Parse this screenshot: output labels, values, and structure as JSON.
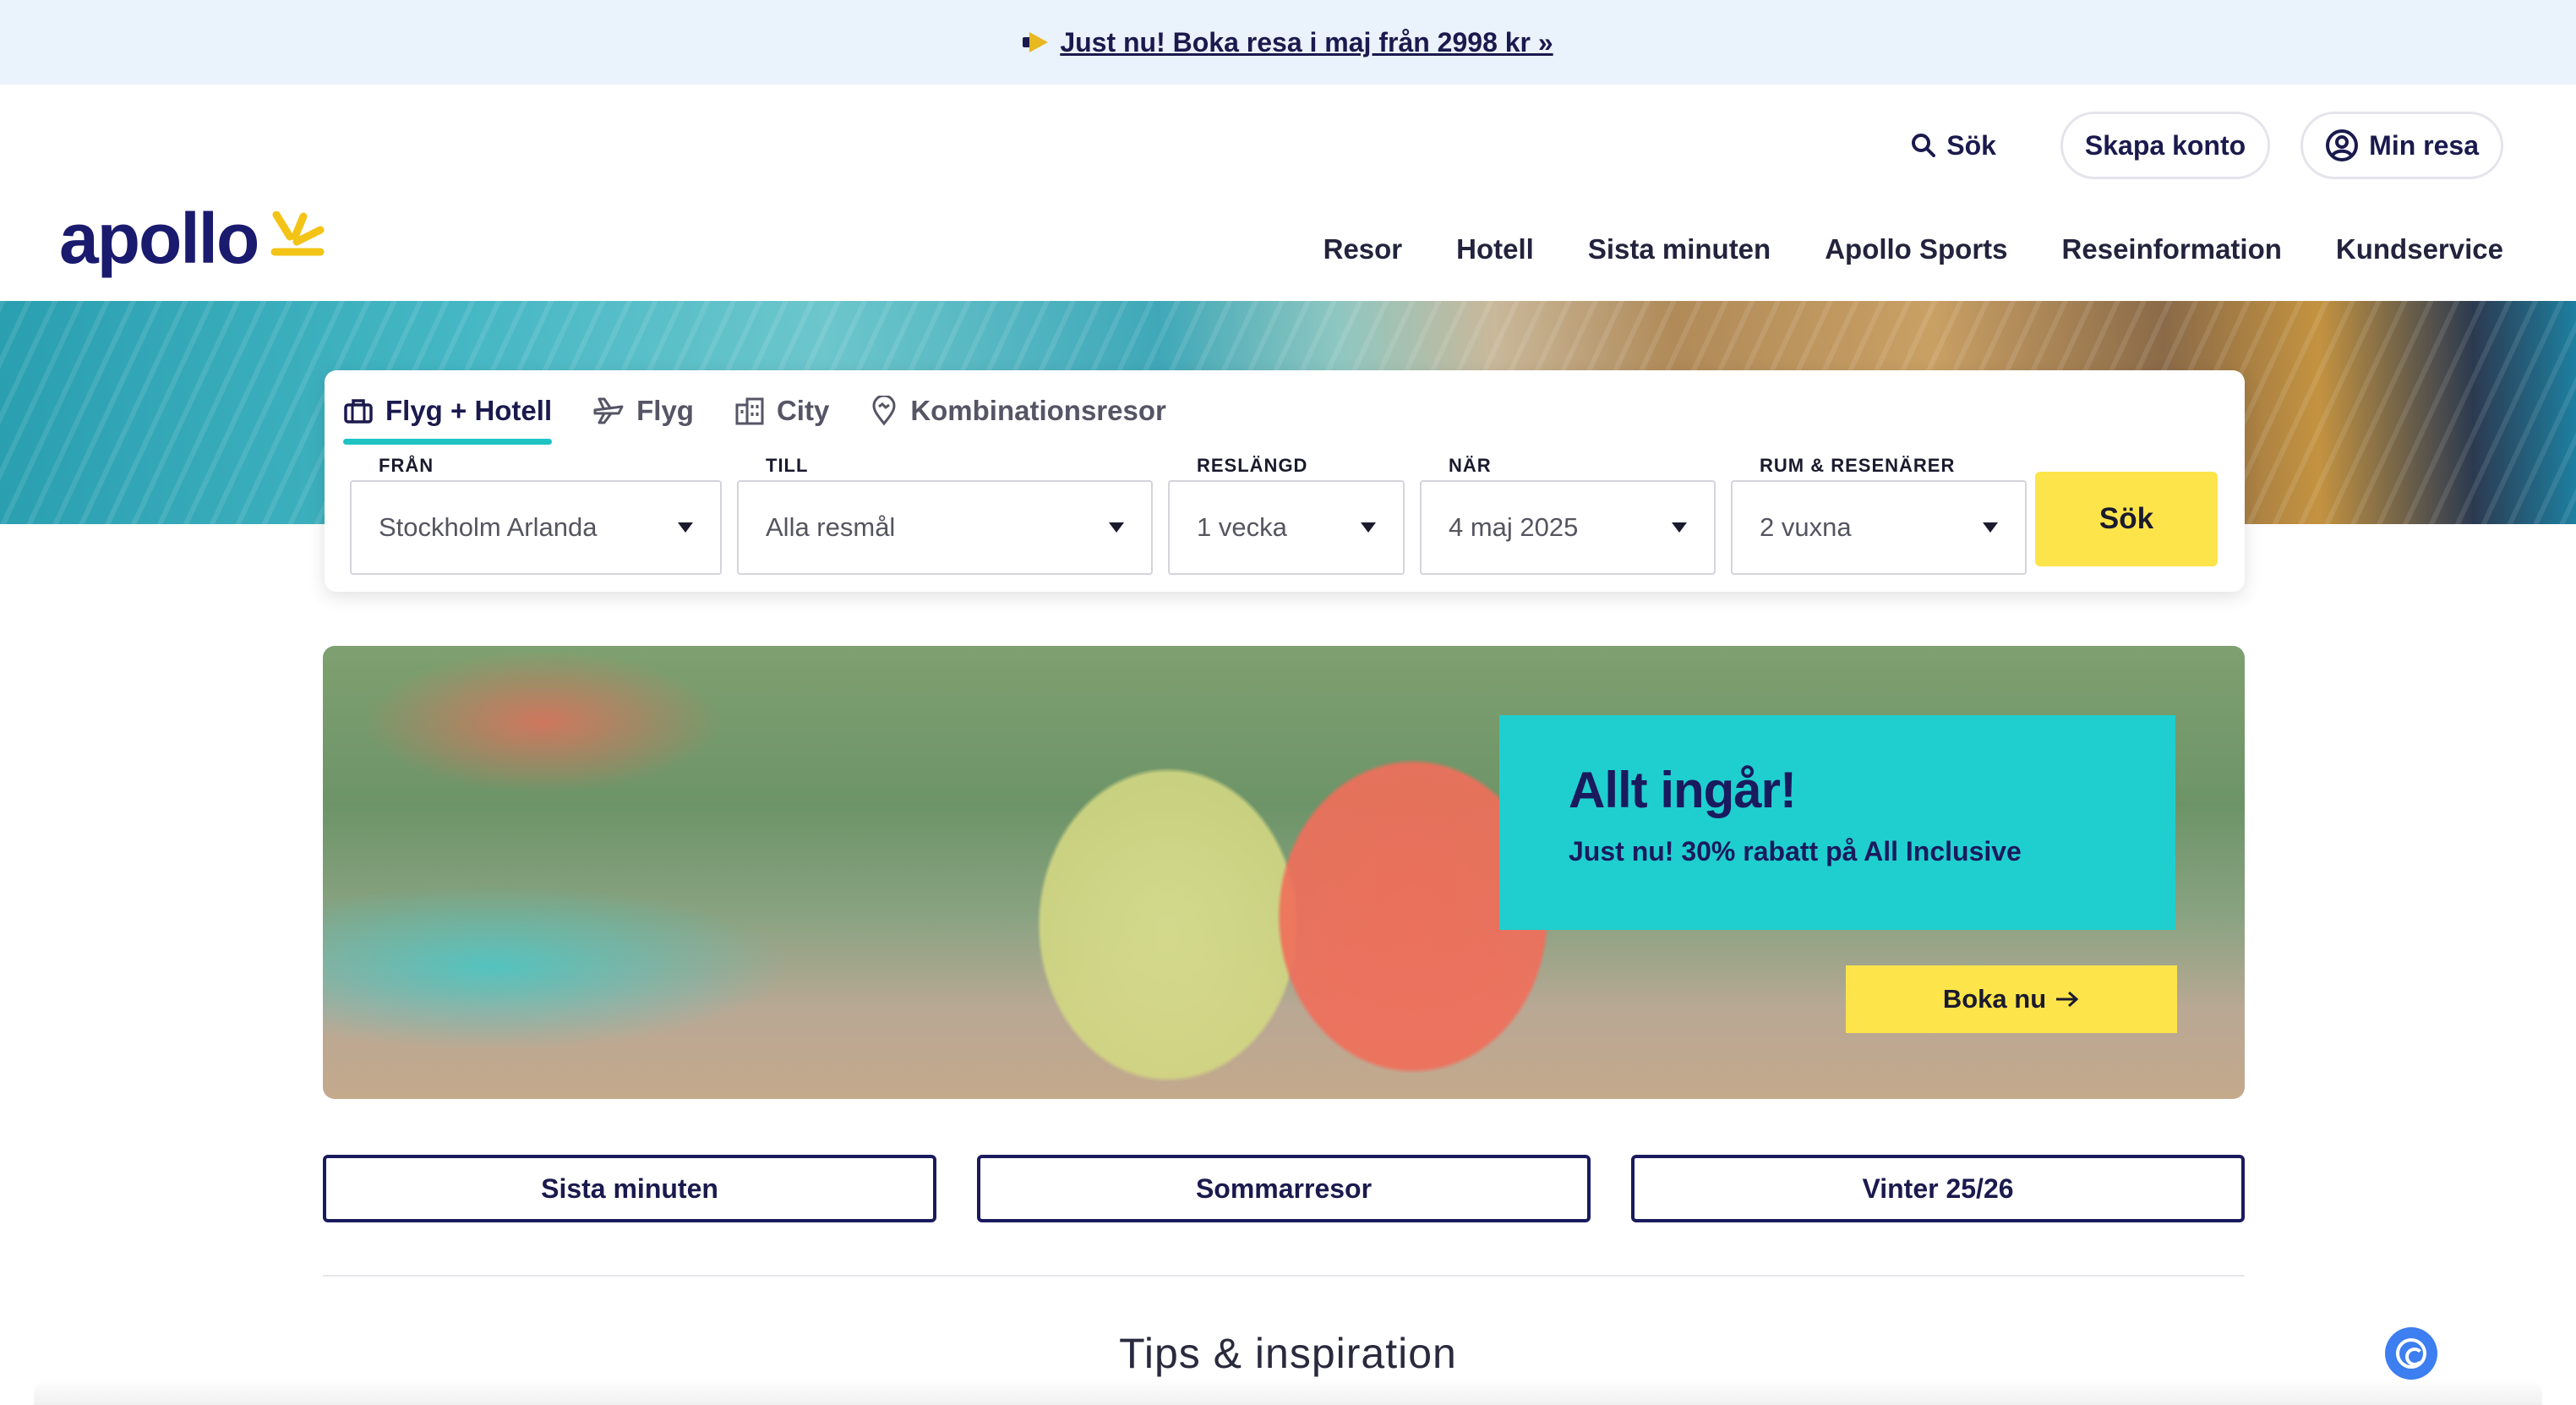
{
  "promo_bar": {
    "text": "Just nu! Boka resa i maj från 2998 kr »"
  },
  "header": {
    "logo_text": "apollo",
    "utility": {
      "search_label": "Sök",
      "create_account": "Skapa konto",
      "my_trip": "Min resa"
    },
    "nav": [
      "Resor",
      "Hotell",
      "Sista minuten",
      "Apollo Sports",
      "Reseinformation",
      "Kundservice"
    ]
  },
  "search": {
    "tabs": [
      {
        "label": "Flyg + Hotell",
        "icon": "suitcase-icon",
        "active": true
      },
      {
        "label": "Flyg",
        "icon": "plane-icon",
        "active": false
      },
      {
        "label": "City",
        "icon": "city-icon",
        "active": false
      },
      {
        "label": "Kombinationsresor",
        "icon": "location-pin-icon",
        "active": false
      }
    ],
    "fields": [
      {
        "label": "FRÅN",
        "value": "Stockholm Arlanda"
      },
      {
        "label": "TILL",
        "value": "Alla resmål"
      },
      {
        "label": "RESLÄNGD",
        "value": "1 vecka"
      },
      {
        "label": "NÄR",
        "value": "4 maj 2025"
      },
      {
        "label": "RUM & RESENÄRER",
        "value": "2 vuxna"
      }
    ],
    "submit_label": "Sök"
  },
  "banner": {
    "title": "Allt ingår!",
    "subtitle": "Just nu! 30% rabatt på All Inclusive",
    "cta": "Boka nu"
  },
  "quick_links": [
    "Sista minuten",
    "Sommarresor",
    "Vinter 25/26"
  ],
  "section_title": "Tips & inspiration",
  "colors": {
    "brand_navy": "#1a1a5e",
    "accent_yellow": "#fde44a",
    "accent_teal": "#1fcfcf",
    "promo_bg": "#eaf2fb"
  }
}
